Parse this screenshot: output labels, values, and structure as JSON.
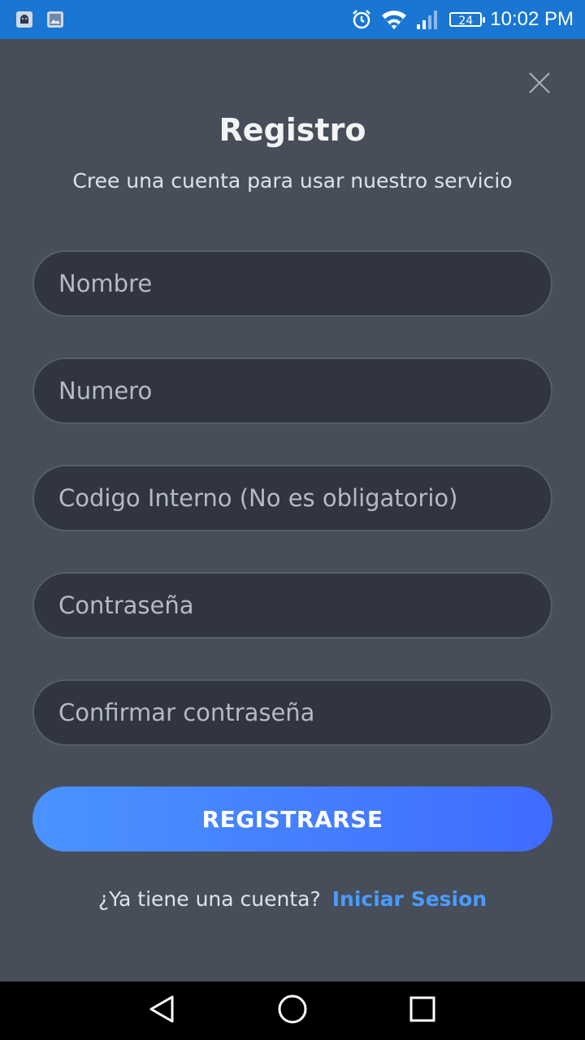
{
  "status_bar": {
    "time": "10:02 PM",
    "battery": "24",
    "icons": [
      "android-notification-icon",
      "image-notification-icon",
      "alarm-icon",
      "wifi-icon",
      "signal-icon",
      "battery-icon"
    ]
  },
  "dialog": {
    "title": "Registro",
    "subtitle": "Cree una cuenta para usar nuestro servicio",
    "close_icon": "close-icon"
  },
  "form": {
    "fields": [
      {
        "name": "nombre",
        "placeholder": "Nombre",
        "value": ""
      },
      {
        "name": "numero",
        "placeholder": "Numero",
        "value": ""
      },
      {
        "name": "codigo-interno",
        "placeholder": "Codigo Interno (No es obligatorio)",
        "value": ""
      },
      {
        "name": "contrasena",
        "placeholder": "Contraseña",
        "value": ""
      },
      {
        "name": "confirmar-contrasena",
        "placeholder": "Confirmar contraseña",
        "value": ""
      }
    ],
    "submit_label": "REGISTRARSE"
  },
  "footer": {
    "question": "¿Ya tiene una cuenta?",
    "link": "Iniciar Sesion"
  },
  "colors": {
    "background": "#474e5a",
    "status_bar": "#1976d2",
    "input_bg": "#30353f",
    "button_gradient_start": "#4a93ff",
    "button_gradient_end": "#3f6cff",
    "link": "#4a9bff"
  },
  "nav_bar": {
    "icons": [
      "back-icon",
      "home-icon",
      "recents-icon"
    ]
  }
}
